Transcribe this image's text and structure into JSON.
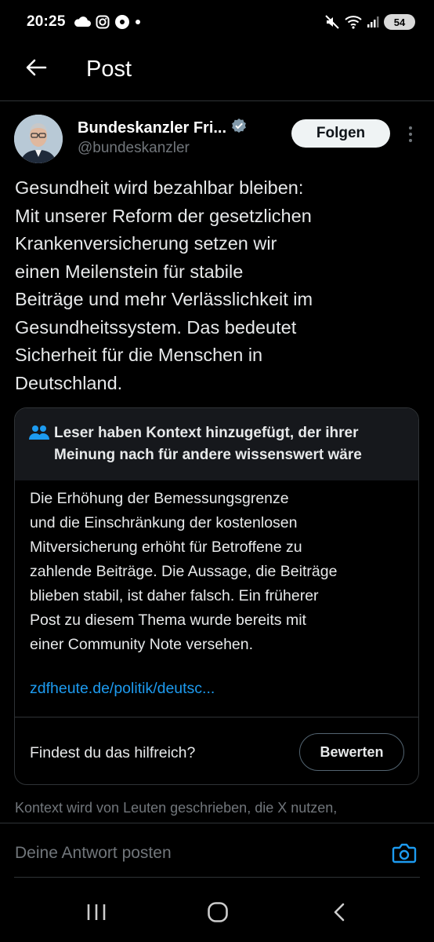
{
  "status_bar": {
    "time": "20:25",
    "battery": "54",
    "left_icons": [
      "cloud-icon",
      "instagram-icon",
      "media-icon",
      "dot-icon"
    ],
    "right_icons": [
      "mute-icon",
      "wifi-icon",
      "signal-icon"
    ]
  },
  "header": {
    "back_icon": "arrow-left-icon",
    "title": "Post"
  },
  "author": {
    "name": "Bundeskanzler Fri...",
    "handle": "@bundeskanzler",
    "verified_badge": "verified-badge-icon",
    "verified_color": "#829aab",
    "follow_label": "Folgen"
  },
  "post": {
    "lines": [
      "Gesundheit wird bezahlbar bleiben:",
      "Mit unserer Reform der gesetzlichen",
      "Krankenversicherung setzen wir",
      "einen Meilenstein für stabile",
      "Beiträge und mehr Verlässlichkeit im",
      "Gesundheitssystem. Das bedeutet",
      "Sicherheit für die Menschen in",
      "Deutschland."
    ]
  },
  "community_note": {
    "title_lines": [
      "Leser haben Kontext hinzugefügt, der ihrer",
      "Meinung nach für andere wissenswert wäre"
    ],
    "body_lines": [
      "Die Erhöhung der Bemessungsgrenze",
      "und die Einschränkung der kostenlosen",
      "Mitversicherung erhöht für Betroffene zu",
      "zahlende Beiträge. Die Aussage, die Beiträge",
      "blieben stabil, ist daher falsch. Ein früherer",
      "Post zu diesem Thema wurde bereits mit",
      "einer Community Note versehen."
    ],
    "link": "zdfheute.de/politik/deutsc...",
    "helpful_question": "Findest du das hilfreich?",
    "rate_label": "Bewerten",
    "footer": "Kontext wird von Leuten geschrieben, die X nutzen,",
    "accent_color": "#1d9bf0"
  },
  "reply": {
    "placeholder": "Deine Antwort posten",
    "camera_icon": "camera-icon"
  },
  "nav": {
    "recents_icon": "recents-icon",
    "home_icon": "home-icon",
    "back_icon": "back-chevron-icon"
  }
}
